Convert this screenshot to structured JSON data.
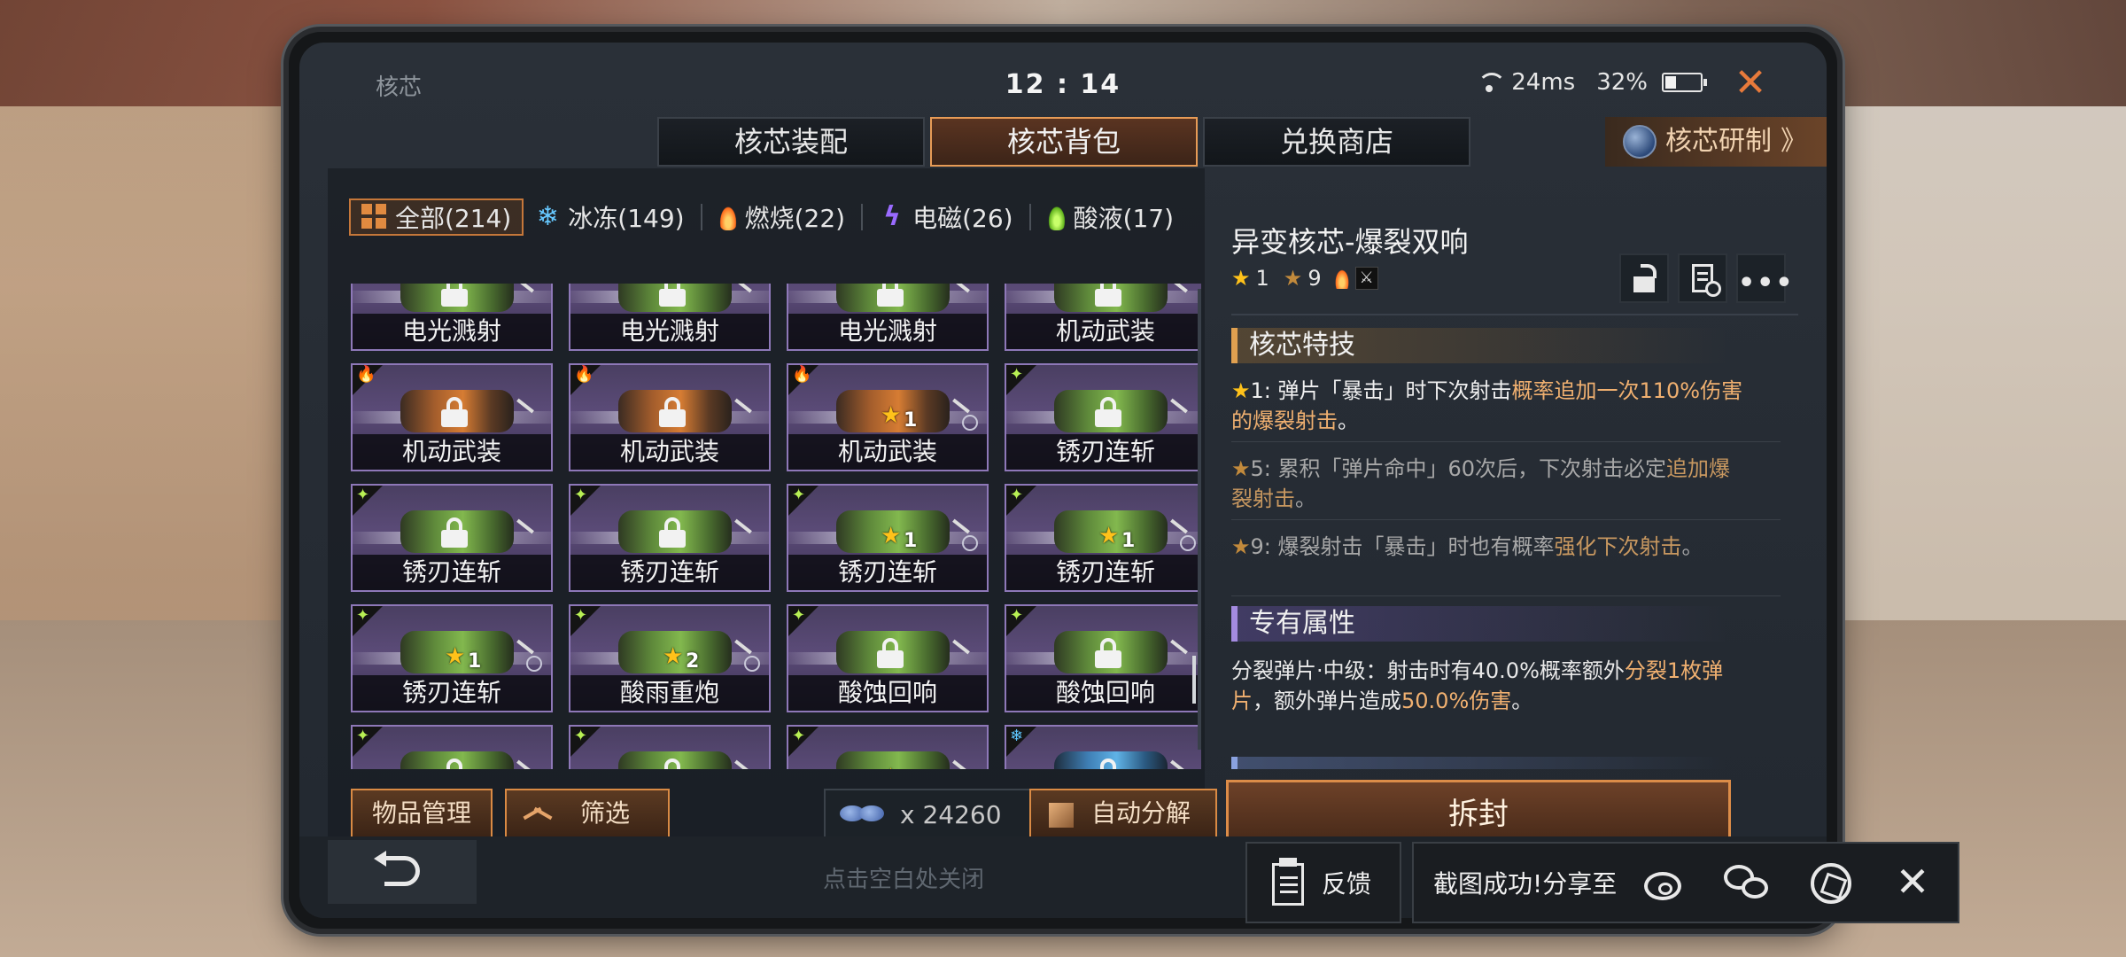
{
  "statusbar": {
    "app_title": "核芯",
    "clock": "12 : 14",
    "latency": "24ms",
    "battery": "32%",
    "battery_level": 0.32
  },
  "tabs": [
    {
      "label": "核芯装配",
      "active": false
    },
    {
      "label": "核芯背包",
      "active": true
    },
    {
      "label": "兑换商店",
      "active": false
    }
  ],
  "research_button": {
    "label": "核芯研制",
    "icon": "globe-icon"
  },
  "filters": [
    {
      "label": "全部(214)",
      "icon": "grid-icon",
      "active": true
    },
    {
      "label": "冰冻(149)",
      "icon": "snowflake-icon",
      "active": false
    },
    {
      "label": "燃烧(22)",
      "icon": "flame-icon",
      "active": false
    },
    {
      "label": "电磁(26)",
      "icon": "lightning-icon",
      "active": false
    },
    {
      "label": "酸液(17)",
      "icon": "acid-drop-icon",
      "active": false
    }
  ],
  "cards": [
    {
      "name": "电光溅射",
      "element": "acid",
      "locked": true,
      "stars": null
    },
    {
      "name": "电光溅射",
      "element": "acid",
      "locked": true,
      "stars": null
    },
    {
      "name": "电光溅射",
      "element": "acid",
      "locked": true,
      "stars": null
    },
    {
      "name": "机动武装",
      "element": "acid",
      "locked": true,
      "stars": null
    },
    {
      "name": "机动武装",
      "element": "fire",
      "locked": true,
      "stars": null
    },
    {
      "name": "机动武装",
      "element": "fire",
      "locked": true,
      "stars": null
    },
    {
      "name": "机动武装",
      "element": "fire",
      "locked": false,
      "stars": "1"
    },
    {
      "name": "锈刃连斩",
      "element": "acid",
      "locked": true,
      "stars": null
    },
    {
      "name": "锈刃连斩",
      "element": "acid",
      "locked": true,
      "stars": null
    },
    {
      "name": "锈刃连斩",
      "element": "acid",
      "locked": true,
      "stars": null
    },
    {
      "name": "锈刃连斩",
      "element": "acid",
      "locked": false,
      "stars": "1"
    },
    {
      "name": "锈刃连斩",
      "element": "acid",
      "locked": false,
      "stars": "1"
    },
    {
      "name": "锈刃连斩",
      "element": "acid",
      "locked": false,
      "stars": "1"
    },
    {
      "name": "酸雨重炮",
      "element": "acid",
      "locked": false,
      "stars": "2"
    },
    {
      "name": "酸蚀回响",
      "element": "acid",
      "locked": true,
      "stars": null
    },
    {
      "name": "酸蚀回响",
      "element": "acid",
      "locked": true,
      "stars": null
    },
    {
      "name": "",
      "element": "acid",
      "locked": true,
      "stars": null
    },
    {
      "name": "",
      "element": "acid",
      "locked": true,
      "stars": null
    },
    {
      "name": "",
      "element": "acid",
      "locked": false,
      "stars": "1"
    },
    {
      "name": "",
      "element": "ice",
      "locked": true,
      "stars": null
    }
  ],
  "bottom": {
    "manage_label": "物品管理",
    "filter_label": "筛选",
    "currency_amount": "x 24260",
    "decompose_label": "自动分解"
  },
  "detail": {
    "title": "异变核芯-爆裂双响",
    "star_gold": "1",
    "star_bronze": "9",
    "section_skill": "核芯特技",
    "skills": [
      {
        "level": "1",
        "pre": "1: 弹片「暴击」时下次射击",
        "hl": "概率追加一次110%伤害的爆裂射击",
        "post": "。",
        "active": true
      },
      {
        "level": "5",
        "pre": "5: 累积「弹片命中」60次后，下次射击必定",
        "hl": "追加爆裂射击",
        "post": "。",
        "active": false
      },
      {
        "level": "9",
        "pre": "9: 爆裂射击「暴击」时也有概率",
        "hl": "强化下次射击",
        "post": "。",
        "active": false
      }
    ],
    "section_attr": "专有属性",
    "attr_pre": "分裂弹片·中级：射击时有40.0%概率额外",
    "attr_hl1": "分裂1枚弹片",
    "attr_mid": "，额外弹片造成",
    "attr_hl2": "50.0%伤害",
    "attr_post": "。",
    "unseal_label": "拆封"
  },
  "bottom_strip": {
    "hint": "点击空白处关闭"
  },
  "feedback": {
    "label": "反馈"
  },
  "share": {
    "label": "截图成功!分享至"
  },
  "colors": {
    "accent": "#e08a40",
    "card_border": "#8e78b8",
    "star": "#ffc21a"
  }
}
